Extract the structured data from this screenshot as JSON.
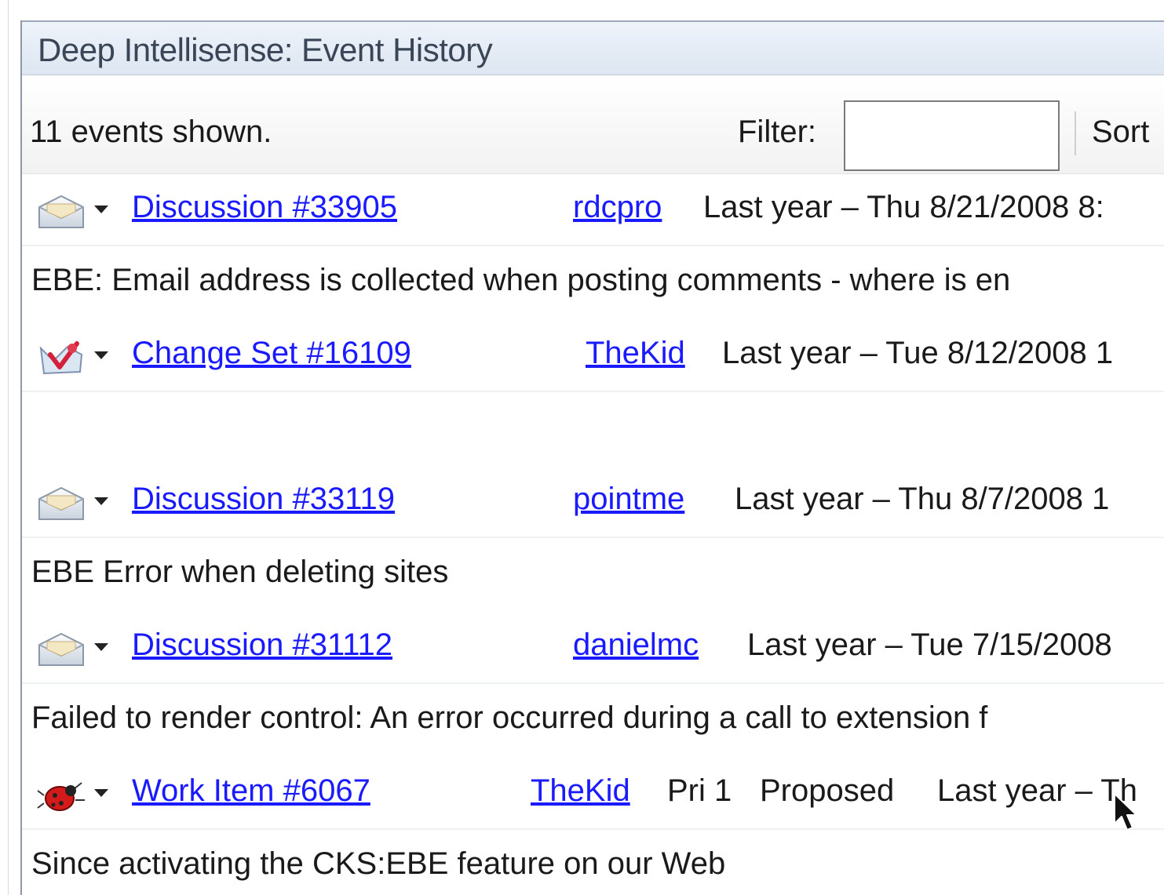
{
  "panel": {
    "title": "Deep Intellisense: Event History"
  },
  "toolbar": {
    "count_text": "11 events shown.",
    "filter_label": "Filter:",
    "filter_value": "",
    "sort_label": "Sort"
  },
  "events": [
    {
      "icon": "envelope-icon",
      "link": "Discussion #33905",
      "user": "rdcpro",
      "meta": "Last year – Thu 8/21/2008 8:",
      "description": "EBE: Email address is collected when posting comments - where is en"
    },
    {
      "icon": "changeset-icon",
      "link": "Change Set #16109",
      "user": "TheKid",
      "meta": "Last year – Tue 8/12/2008 1",
      "description": ""
    },
    {
      "icon": "envelope-icon",
      "link": "Discussion #33119",
      "user": "pointme",
      "meta": "Last year – Thu 8/7/2008 1",
      "description": "EBE Error when deleting sites"
    },
    {
      "icon": "envelope-icon",
      "link": "Discussion #31112",
      "user": "danielmc",
      "meta": "Last year – Tue 7/15/2008",
      "description": "Failed to render control: An error occurred during a call to extension f"
    },
    {
      "icon": "bug-icon",
      "link": "Work Item #6067",
      "user": "TheKid",
      "priority": "Pri 1",
      "state": "Proposed",
      "meta": "Last year – Th",
      "description": "Since activating the CKS:EBE feature on our Web"
    }
  ]
}
